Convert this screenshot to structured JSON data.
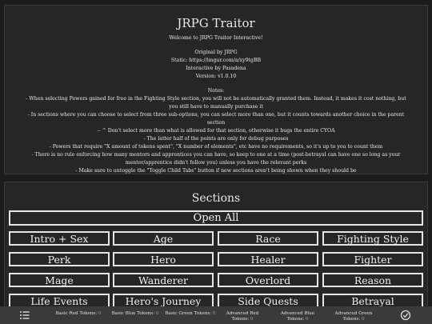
{
  "intro": {
    "title": "JRPG Traitor",
    "welcome": "Welcome to JRPG Traitor Interactive!",
    "original": "Original by JRPG",
    "static": "Static: https://imgur.com/a/xy9tgBB",
    "interactive": "Interactive by Pasadena",
    "version": "Version: v1.0.10",
    "notes_heading": "Notes:",
    "notes": [
      "- When selecting Powers gained for free in the Fighting Style section, you will not be automatically granted them. Instead, it makes it cost nothing, but you still have to manually purchase it",
      "- In sections where you can choose to select from three sub-options, you can select more than one, but it counts towards another choice in the parent section",
      "-- ^ Don't select more than what is allowed for that section, otherwise it bugs the entire CYOA",
      "- The latter half of the points are only for debug purposes",
      "- Powers that require \"X amount of tokens spent\", \"X number of elements\", etc have no requirements, so it's up to you to count them",
      "- There is no rule enforcing how many mentors and apprentices you can have, so keep to one at a time (post-betrayal can have one so long as your mentor/apprentice didn't follow you) unless you have the relevant perks",
      "- Make sure to untoggle the \"Toggle Child Tabs\" button if new sections aren't being shown when they should be"
    ]
  },
  "sections": {
    "title": "Sections",
    "open_all": "Open All",
    "buttons": [
      "Intro + Sex",
      "Age",
      "Race",
      "Fighting Style",
      "Perk",
      "Hero",
      "Healer",
      "Fighter",
      "Mage",
      "Wanderer",
      "Overlord",
      "Reason",
      "Life Events",
      "Hero's Journey",
      "Side Quests",
      "Betrayal"
    ]
  },
  "tokens": [
    {
      "label": "Basic Red Tokens:",
      "value": "0"
    },
    {
      "label": "Basic Blue Tokens:",
      "value": "0"
    },
    {
      "label": "Basic Green Tokens:",
      "value": "0"
    },
    {
      "label": "Advanced Red Tokens:",
      "value": "0"
    },
    {
      "label": "Advanced Blue Tokens:",
      "value": "0"
    },
    {
      "label": "Advanced Green Tokens:",
      "value": "0"
    }
  ],
  "icons": {
    "left": "menu-list-icon",
    "right": "checklist-icon"
  }
}
